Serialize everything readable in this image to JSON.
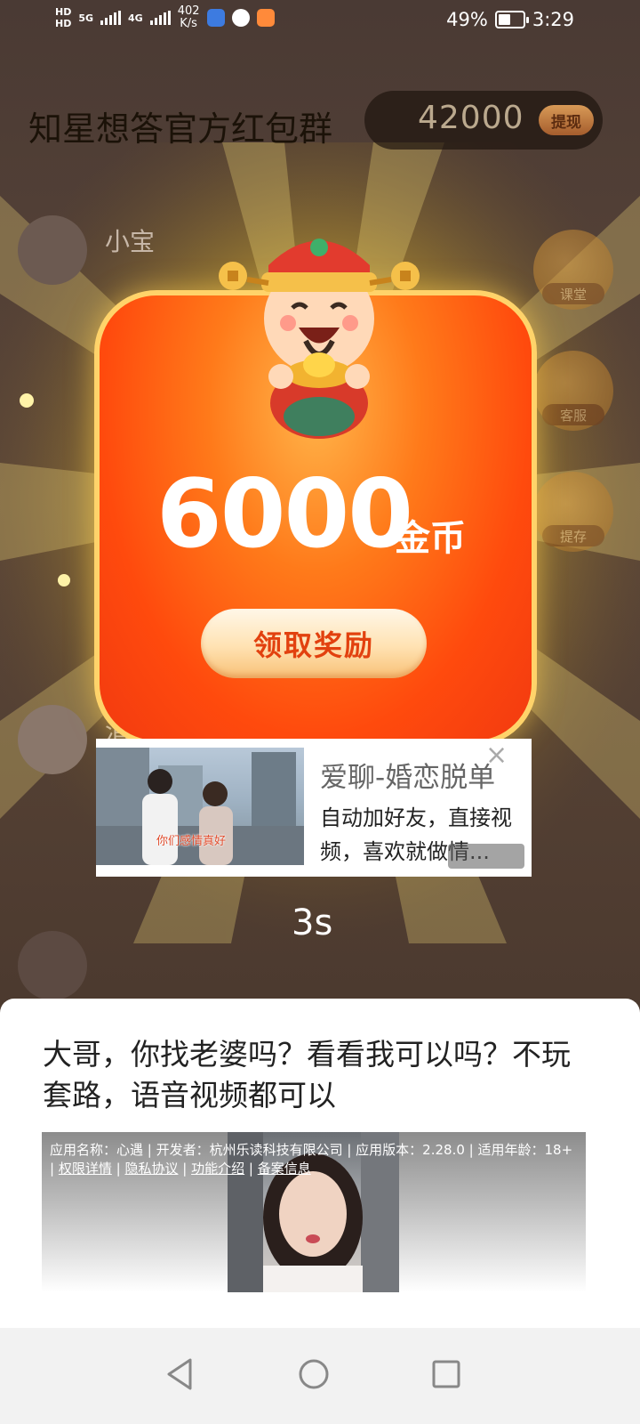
{
  "status_bar": {
    "net_type": "5G",
    "net_type_2": "4G",
    "speed_value": "402",
    "speed_unit": "K/s",
    "battery": "49%",
    "time": "3:29"
  },
  "background": {
    "group_title": "知星想答官方红包群",
    "coin_balance": "42000",
    "withdraw_label": "提现",
    "member_name_1": "小宝",
    "member_name_2": "涓",
    "side_buttons": [
      "课堂",
      "客服",
      "提存"
    ]
  },
  "reward": {
    "amount": "6000",
    "unit": "金币",
    "claim_label": "领取奖励"
  },
  "ad_banner": {
    "title": "爱聊-婚恋脱单",
    "description": "自动加好友，直接视频，喜欢就做情...",
    "thumb_caption": "你们感情真好"
  },
  "countdown": "3s",
  "bottom_ad": {
    "headline": "大哥，你找老婆吗？看看我可以吗？不玩套路，语音视频都可以",
    "info_line1": "应用名称：心遇 | 开发者：杭州乐读科技有限公司 | 应用版本：2.28.0 | 适用年龄：18+",
    "info_sep": "| ",
    "link_permissions": "权限详情",
    "link_privacy": "隐私协议",
    "link_features": "功能介绍",
    "link_filing": "备案信息"
  },
  "colors": {
    "reward_orange": "#ff4a0d",
    "reward_gold": "#ffd36a",
    "claim_text": "#e2410f"
  },
  "icons": {
    "nav_back": "back-triangle-icon",
    "nav_home": "home-circle-icon",
    "nav_recent": "recent-square-icon",
    "ad_close": "close-icon"
  }
}
